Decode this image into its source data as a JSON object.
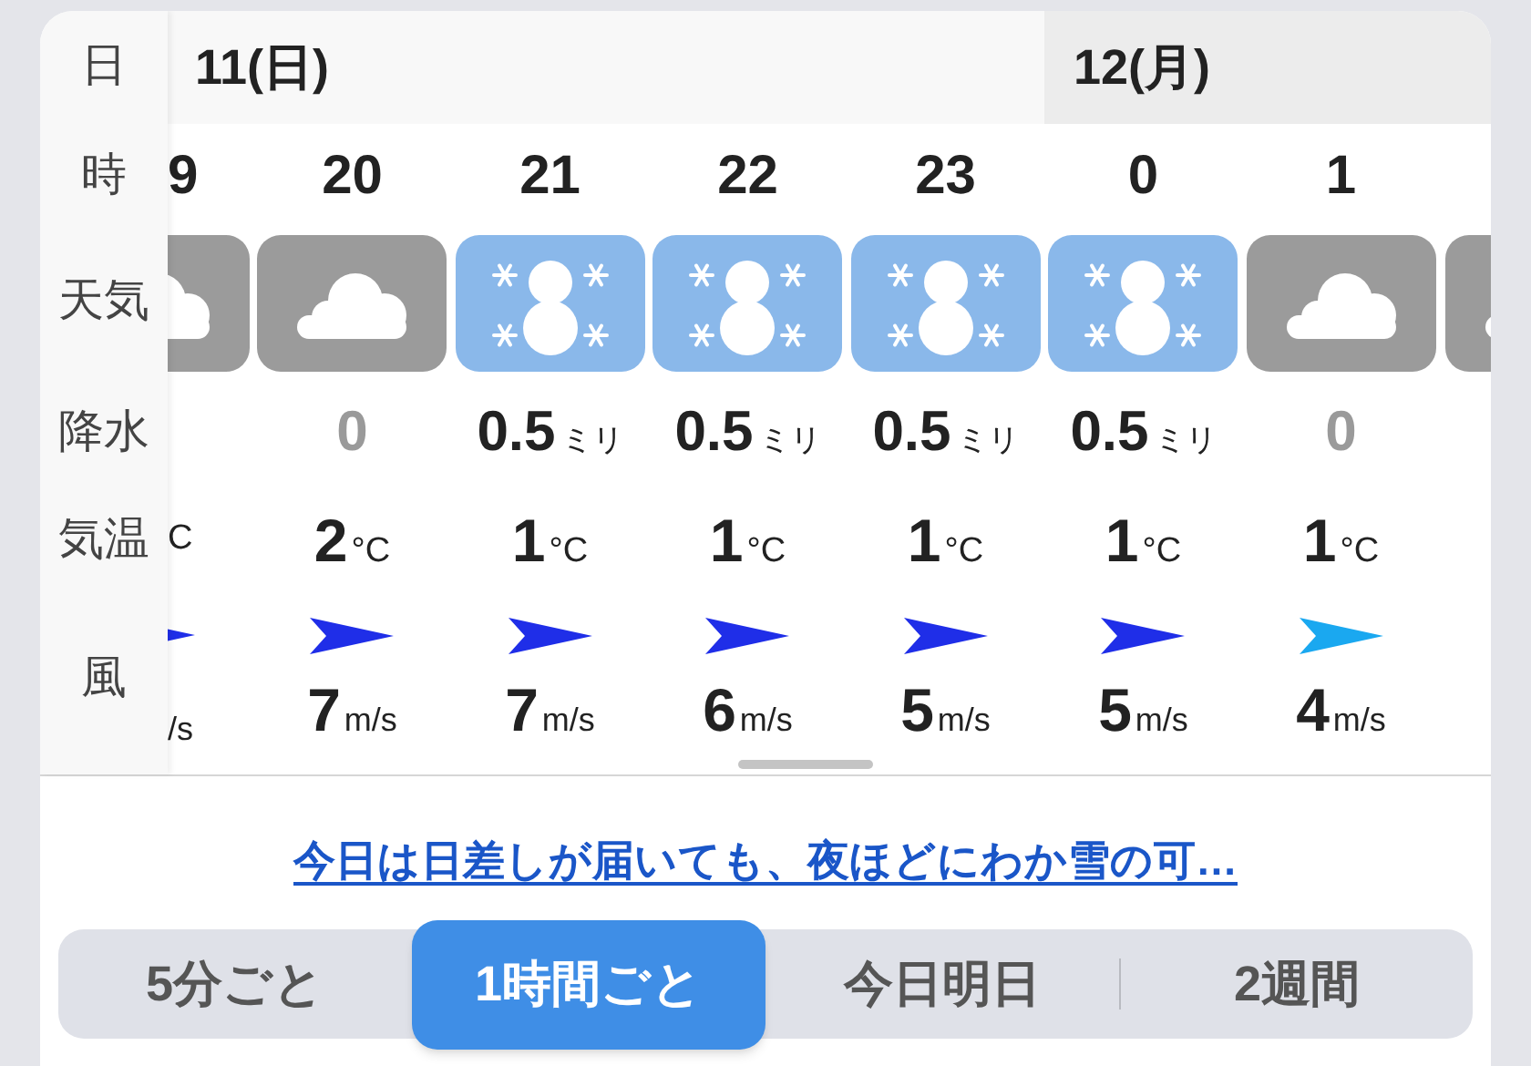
{
  "row_labels": [
    "日",
    "時",
    "天気",
    "降水",
    "気温",
    "風"
  ],
  "days": [
    {
      "label": "11(日)",
      "shaded": false
    },
    {
      "label": "12(月)",
      "shaded": true
    }
  ],
  "hours": [
    {
      "kind": "partial_left",
      "hour": "9",
      "weather": {
        "kind": "cloudy"
      },
      "temp_unit": "C",
      "wind": {
        "color": "#1f2ee8"
      },
      "speed_unit": "/s"
    },
    {
      "kind": "full",
      "hour": "20",
      "weather": {
        "kind": "cloudy"
      },
      "precip": "0",
      "dry": true,
      "temp": "2",
      "temp_unit": "°C",
      "wind": {
        "color": "#1f2ee8"
      },
      "speed": "7",
      "speed_unit": "m/s"
    },
    {
      "kind": "full",
      "hour": "21",
      "weather": {
        "kind": "snow"
      },
      "precip": "0.5",
      "precip_unit": "ミリ",
      "dry": false,
      "temp": "1",
      "temp_unit": "°C",
      "wind": {
        "color": "#1f2ee8"
      },
      "speed": "7",
      "speed_unit": "m/s"
    },
    {
      "kind": "full",
      "hour": "22",
      "weather": {
        "kind": "snow"
      },
      "precip": "0.5",
      "precip_unit": "ミリ",
      "dry": false,
      "temp": "1",
      "temp_unit": "°C",
      "wind": {
        "color": "#1f2ee8"
      },
      "speed": "6",
      "speed_unit": "m/s"
    },
    {
      "kind": "full",
      "hour": "23",
      "weather": {
        "kind": "snow"
      },
      "precip": "0.5",
      "precip_unit": "ミリ",
      "dry": false,
      "temp": "1",
      "temp_unit": "°C",
      "wind": {
        "color": "#1f2ee8"
      },
      "speed": "5",
      "speed_unit": "m/s"
    },
    {
      "kind": "full",
      "hour": "0",
      "weather": {
        "kind": "snow"
      },
      "precip": "0.5",
      "precip_unit": "ミリ",
      "dry": false,
      "temp": "1",
      "temp_unit": "°C",
      "wind": {
        "color": "#1f2ee8"
      },
      "speed": "5",
      "speed_unit": "m/s"
    },
    {
      "kind": "full",
      "hour": "1",
      "weather": {
        "kind": "cloudy"
      },
      "precip": "0",
      "dry": true,
      "temp": "1",
      "temp_unit": "°C",
      "wind": {
        "color": "#1aa8f0"
      },
      "speed": "4",
      "speed_unit": "m/s"
    },
    {
      "kind": "partial_right",
      "weather": {
        "kind": "cloudy"
      }
    }
  ],
  "headline": "今日は日差しが届いても、夜ほどにわか雪の可…",
  "tabs": [
    {
      "label": "5分ごと",
      "selected": false
    },
    {
      "label": "1時間ごと",
      "selected": true
    },
    {
      "label": "今日明日",
      "selected": false
    },
    {
      "label": "2週間",
      "selected": false
    }
  ]
}
